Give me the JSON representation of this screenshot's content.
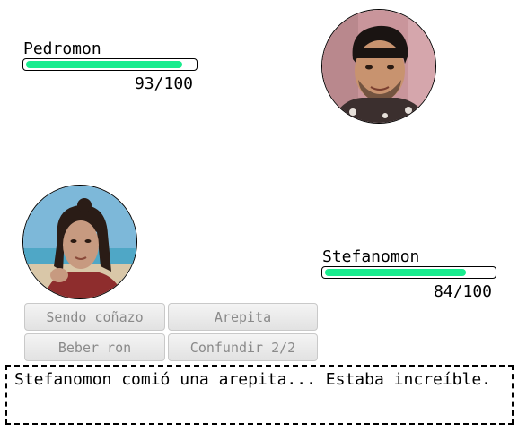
{
  "opponent": {
    "name": "Pedromon",
    "hp_text": "93/100",
    "hp_fraction": 0.93,
    "portrait_icon": "opponent-face-photo"
  },
  "player": {
    "name": "Stefanomon",
    "hp_text": "84/100",
    "hp_fraction": 0.84,
    "portrait_icon": "player-face-photo"
  },
  "moves": [
    {
      "label": "Sendo coñazo"
    },
    {
      "label": "Arepita"
    },
    {
      "label": "Beber ron"
    },
    {
      "label": "Confundir 2/2"
    }
  ],
  "message": "Stefanomon comió una arepita... Estaba increíble.",
  "colors": {
    "hp_fill": "#19ec8e",
    "button_text": "#8a8a8a"
  }
}
